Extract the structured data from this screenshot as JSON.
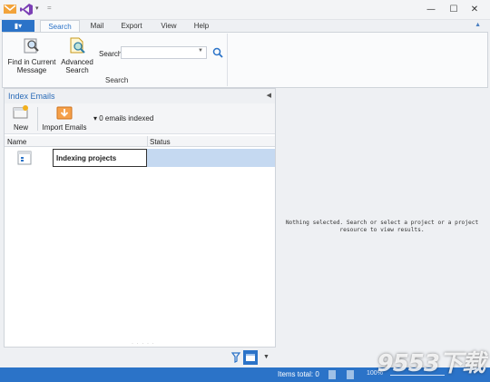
{
  "titlebar": {
    "quick_access": "=",
    "minimize": "—",
    "maximize": "☐",
    "close": "✕"
  },
  "ribbon": {
    "file_label": "▮▾",
    "tabs": [
      {
        "label": "Search",
        "active": true
      },
      {
        "label": "Mail",
        "active": false
      },
      {
        "label": "Export",
        "active": false
      },
      {
        "label": "View",
        "active": false
      },
      {
        "label": "Help",
        "active": false
      }
    ],
    "find_in_current_message": "Find in Current Message",
    "advanced_search": "Advanced Search",
    "search_label": "Search",
    "search_value": "",
    "group_label": "Search"
  },
  "panel": {
    "title": "Index Emails",
    "toolbar": {
      "new_label": "New",
      "import_label": "Import Emails",
      "indexed_status": "0 emails indexed"
    },
    "columns": {
      "name": "Name",
      "status": "Status"
    },
    "rows": [
      {
        "name": "Indexing projects",
        "status": ""
      }
    ]
  },
  "content": {
    "empty_message": "Nothing selected. Search or select a project or a project resource to view results."
  },
  "statusbar": {
    "items_total": "Items total: 0",
    "zoom": "100%"
  },
  "watermark": "9553下载",
  "colors": {
    "accent": "#2b73c8",
    "selection": "#c5d9f1",
    "panel_title": "#2b6cb8"
  }
}
